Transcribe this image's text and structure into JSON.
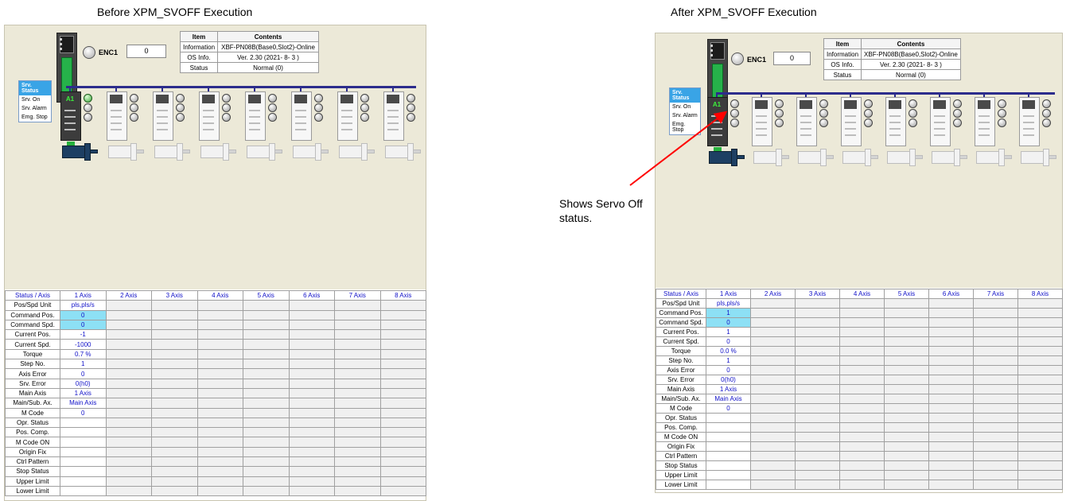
{
  "captions": {
    "before": "Before XPM_SVOFF Execution",
    "after": "After XPM_SVOFF Execution"
  },
  "annotation": {
    "text_line1": "Shows Servo Off",
    "text_line2": "status.",
    "arrow_color": "#ff0000"
  },
  "before": {
    "encoder": {
      "label": "ENC1",
      "value": "0"
    },
    "info_table": {
      "headers": [
        "Item",
        "Contents"
      ],
      "rows": [
        [
          "Information",
          "XBF-PN08B(Base0,Slot2)-Online"
        ],
        [
          "OS Info.",
          "Ver.  2.30 (2021- 8- 3 )"
        ],
        [
          "Status",
          "Normal (0)"
        ]
      ]
    },
    "servo_legend": {
      "title": "Srv. Status",
      "items": [
        "Srv. On",
        "Srv. Alarm",
        "Emg. Stop"
      ]
    },
    "axis1_display": "A1",
    "axis1_lamp_on": true,
    "status_table": {
      "header": [
        "Status / Axis",
        "1 Axis",
        "2 Axis",
        "3 Axis",
        "4 Axis",
        "5 Axis",
        "6 Axis",
        "7 Axis",
        "8 Axis"
      ],
      "rows": [
        [
          "Pos/Spd Unit",
          "pls,pls/s"
        ],
        [
          "Command Pos.",
          "0"
        ],
        [
          "Command Spd.",
          "0"
        ],
        [
          "Current Pos.",
          "-1"
        ],
        [
          "Current Spd.",
          "-1000"
        ],
        [
          "Torque",
          "0.7 %"
        ],
        [
          "Step No.",
          "1"
        ],
        [
          "Axis Error",
          "0"
        ],
        [
          "Srv. Error",
          "0(h0)"
        ],
        [
          "Main Axis",
          "1 Axis"
        ],
        [
          "Main/Sub. Ax.",
          "Main Axis"
        ],
        [
          "M Code",
          "0"
        ],
        [
          "Opr. Status",
          ""
        ],
        [
          "Pos. Comp.",
          ""
        ],
        [
          "M Code ON",
          ""
        ],
        [
          "Origin Fix",
          ""
        ],
        [
          "Ctrl Pattern",
          ""
        ],
        [
          "Stop Status",
          ""
        ],
        [
          "Upper Limit",
          ""
        ],
        [
          "Lower Limit",
          ""
        ]
      ],
      "highlight_rows": [
        1,
        2
      ]
    }
  },
  "after": {
    "encoder": {
      "label": "ENC1",
      "value": "0"
    },
    "info_table": {
      "headers": [
        "Item",
        "Contents"
      ],
      "rows": [
        [
          "Information",
          "XBF-PN08B(Base0,Slot2)-Online"
        ],
        [
          "OS Info.",
          "Ver.  2.30 (2021- 8- 3 )"
        ],
        [
          "Status",
          "Normal (0)"
        ]
      ]
    },
    "servo_legend": {
      "title": "Srv. Status",
      "items": [
        "Srv. On",
        "Srv. Alarm",
        "Emg. Stop"
      ]
    },
    "axis1_display": "A1",
    "axis1_lamp_on": false,
    "status_table": {
      "header": [
        "Status / Axis",
        "1 Axis",
        "2 Axis",
        "3 Axis",
        "4 Axis",
        "5 Axis",
        "6 Axis",
        "7 Axis",
        "8 Axis"
      ],
      "rows": [
        [
          "Pos/Spd Unit",
          "pls,pls/s"
        ],
        [
          "Command Pos.",
          "1"
        ],
        [
          "Command Spd.",
          "0"
        ],
        [
          "Current Pos.",
          "1"
        ],
        [
          "Current Spd.",
          "0"
        ],
        [
          "Torque",
          "0.0 %"
        ],
        [
          "Step No.",
          "1"
        ],
        [
          "Axis Error",
          "0"
        ],
        [
          "Srv. Error",
          "0(h0)"
        ],
        [
          "Main Axis",
          "1 Axis"
        ],
        [
          "Main/Sub. Ax.",
          "Main Axis"
        ],
        [
          "M Code",
          "0"
        ],
        [
          "Opr. Status",
          ""
        ],
        [
          "Pos. Comp.",
          ""
        ],
        [
          "M Code ON",
          ""
        ],
        [
          "Origin Fix",
          ""
        ],
        [
          "Ctrl Pattern",
          ""
        ],
        [
          "Stop Status",
          ""
        ],
        [
          "Upper Limit",
          ""
        ],
        [
          "Lower Limit",
          ""
        ]
      ],
      "highlight_rows": [
        1,
        2
      ]
    }
  }
}
